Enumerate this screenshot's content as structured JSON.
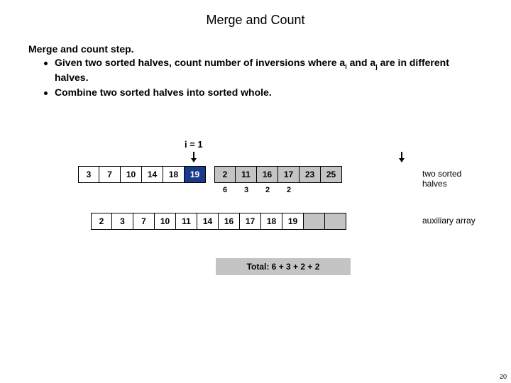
{
  "title": "Merge and Count",
  "heading": "Merge and count step.",
  "bullets": {
    "b1_pre": "Given two sorted halves, count number of inversions where a",
    "b1_sub1": "i",
    "b1_mid": " and a",
    "b1_sub2": "j",
    "b1_post": " are in different halves.",
    "b2": "Combine two sorted halves into sorted whole."
  },
  "i_label": "i = 1",
  "left_half": [
    "3",
    "7",
    "10",
    "14",
    "18",
    "19"
  ],
  "right_half": [
    "2",
    "11",
    "16",
    "17",
    "23",
    "25"
  ],
  "dark_left_index": 5,
  "counts": [
    "6",
    "3",
    "2",
    "2",
    "",
    ""
  ],
  "aux": [
    "2",
    "3",
    "7",
    "10",
    "11",
    "14",
    "16",
    "17",
    "18",
    "19",
    "",
    ""
  ],
  "aux_filled_count": 10,
  "label_halves": "two sorted halves",
  "label_aux": "auxiliary array",
  "total": "Total:  6 + 3 + 2 + 2",
  "pagenum": "20"
}
